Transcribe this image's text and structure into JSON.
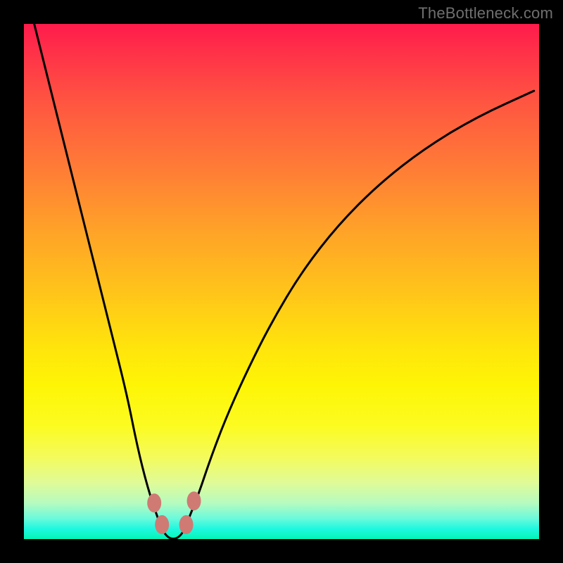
{
  "watermark": "TheBottleneck.com",
  "chart_data": {
    "type": "line",
    "title": "",
    "xlabel": "",
    "ylabel": "",
    "xlim": [
      0,
      100
    ],
    "ylim": [
      0,
      100
    ],
    "series": [
      {
        "name": "bottleneck-curve",
        "x": [
          2,
          5,
          8,
          11,
          14,
          17,
          20,
          22,
          24,
          26,
          27,
          28,
          29,
          30,
          31,
          32,
          34,
          36,
          39,
          43,
          48,
          54,
          61,
          69,
          78,
          88,
          99
        ],
        "values": [
          100,
          88,
          76,
          64,
          52,
          40,
          28,
          18,
          10,
          4,
          1.5,
          0.3,
          0,
          0.3,
          1.5,
          4,
          9,
          15,
          23,
          32,
          42,
          52,
          61,
          69,
          76,
          82,
          87
        ]
      }
    ],
    "markers": [
      {
        "name": "left-upper-dot",
        "x": 25.3,
        "y": 7.0
      },
      {
        "name": "left-lower-dot",
        "x": 26.8,
        "y": 2.8
      },
      {
        "name": "right-lower-dot",
        "x": 31.5,
        "y": 2.8
      },
      {
        "name": "right-upper-dot",
        "x": 33.0,
        "y": 7.4
      }
    ],
    "colors": {
      "curve": "#000000",
      "curve_width": 3,
      "marker_fill": "#d07a74",
      "marker_radius": 10,
      "gradient_top": "#ff1b4c",
      "gradient_bottom": "#04f6b4"
    }
  }
}
